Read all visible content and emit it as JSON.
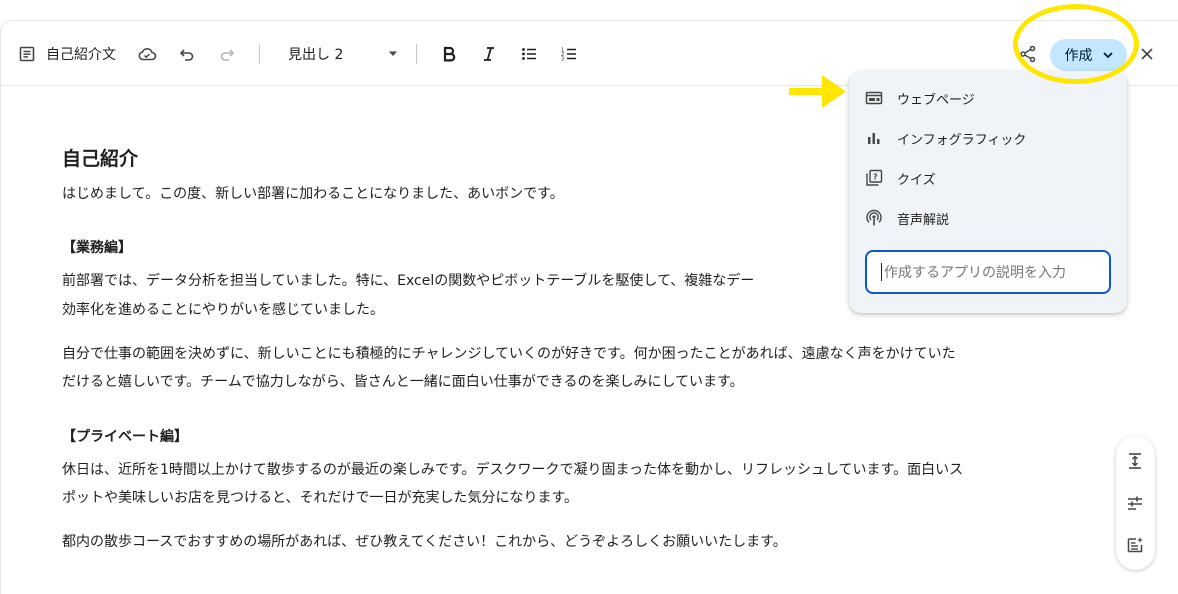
{
  "toolbar": {
    "doc_title": "自己紹介文",
    "heading_style": "見出し 2",
    "create_label": "作成"
  },
  "menu": {
    "items": [
      {
        "label": "ウェブページ",
        "icon": "webpage-icon"
      },
      {
        "label": "インフォグラフィック",
        "icon": "bar-chart-icon"
      },
      {
        "label": "クイズ",
        "icon": "quiz-icon"
      },
      {
        "label": "音声解説",
        "icon": "podcast-icon"
      }
    ],
    "input_placeholder": "作成するアプリの説明を入力"
  },
  "document": {
    "heading": "自己紹介",
    "intro": "はじめまして。この度、新しい部署に加わることになりました、あいボンです。",
    "section1_title": "【業務編】",
    "section1_p1_line1": "前部署では、データ分析を担当していました。特に、Excelの関数やピボットテーブルを駆使して、複雑なデー",
    "section1_p1_line2": "効率化を進めることにやりがいを感じていました。",
    "section1_p2_line1": "自分で仕事の範囲を決めずに、新しいことにも積極的にチャレンジしていくのが好きです。何か困ったことがあれば、遠慮なく声をかけていた",
    "section1_p2_line2": "だけると嬉しいです。チームで協力しながら、皆さんと一緒に面白い仕事ができるのを楽しみにしています。",
    "section2_title": "【プライベート編】",
    "section2_p1_line1": "休日は、近所を1時間以上かけて散歩するのが最近の楽しみです。デスクワークで凝り固まった体を動かし、リフレッシュしています。面白いス",
    "section2_p1_line2": "ポットや美味しいお店を見つけると、それだけで一日が充実した気分になります。",
    "section2_p2": "都内の散歩コースでおすすめの場所があれば、ぜひ教えてください！これから、どうぞよろしくお願いいたします。"
  },
  "annotation": {
    "highlight_color": "#ffe600"
  },
  "colors": {
    "accent": "#c2e7ff",
    "focus": "#0b57d0",
    "menu_bg": "#f0f4f9"
  }
}
